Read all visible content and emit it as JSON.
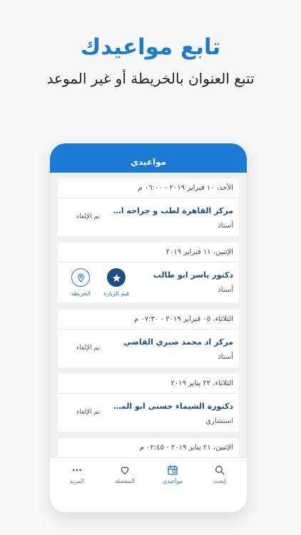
{
  "hero": {
    "title": "تابع مواعيدك",
    "subtitle": "تتبع العنوان بالخريطة أو غير الموعد"
  },
  "app": {
    "header_title": "مواعيدي"
  },
  "appointments": [
    {
      "date": "الأحد، ١٠ فبراير ٢٠١٩ - ٠٦:٠٠ م",
      "doctor": "مركز القاهرة لطب و جراحه الفم و...",
      "title": "أستاذ",
      "status": "تم الإلغاء"
    },
    {
      "date": "الإثنين، ١١ فبراير ٢٠١٩",
      "doctor": "دكتور ياسر ابو طالب",
      "title": "أستاذ",
      "actions": {
        "rate": "قيم الزيارة",
        "map": "الخريطة"
      }
    },
    {
      "date": "الثلاثاء، ٠٥ فبراير ٢٠١٩ - ٠٧:٣٠ م",
      "doctor": "مركز اد محمد صبري القاضي",
      "title": "أستاذ",
      "status": "تم الإلغاء"
    },
    {
      "date": "الثلاثاء، ٢٢ يناير ٢٠١٩",
      "doctor": "دكتورة الشيماء حسنى ابو المعا...",
      "title": "استشاري",
      "status": "تم الإلغاء"
    },
    {
      "date": "الإثنين، ٢١ يناير ٢٠١٩ - ٠٢:٤٥ م"
    }
  ],
  "tabs": [
    {
      "label": "إبحث",
      "icon": "search-icon"
    },
    {
      "label": "مواعيدي",
      "icon": "calendar-icon",
      "active": true
    },
    {
      "label": "المفضلة",
      "icon": "heart-icon"
    },
    {
      "label": "المزيد",
      "icon": "more-dots-icon"
    }
  ],
  "colors": {
    "primary": "#1a7ad4",
    "doctor_name": "#1b4f8a",
    "background": "#f0f0f2"
  }
}
